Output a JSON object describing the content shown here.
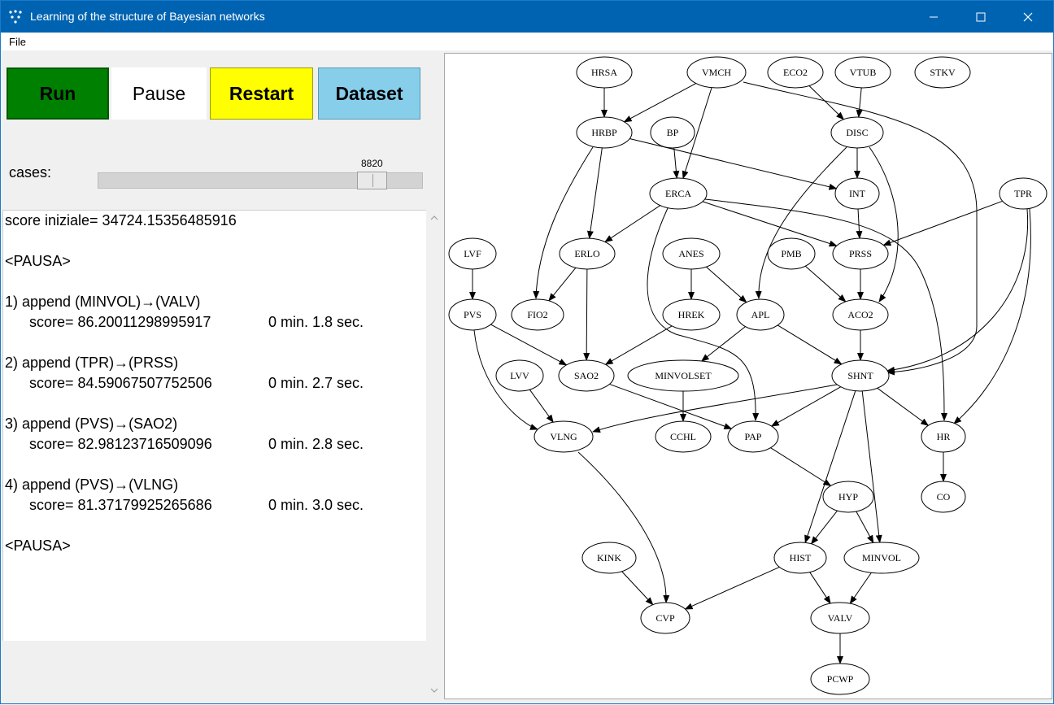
{
  "window": {
    "title": "Learning of the structure of Bayesian networks",
    "menu": [
      "File"
    ]
  },
  "toolbar": {
    "run_label": "Run",
    "pause_label": "Pause",
    "restart_label": "Restart",
    "dataset_label": "Dataset"
  },
  "cases": {
    "label": "cases:",
    "value": "8820"
  },
  "log": {
    "initial": "score iniziale= 34724.15356485916",
    "pause": "<PAUSA>",
    "steps": [
      {
        "action": "1) append (MINVOL)→(VALV)",
        "score": "score= 86.20011298995917",
        "time": "0 min. 1.8 sec."
      },
      {
        "action": "2) append (TPR)→(PRSS)",
        "score": "score= 84.59067507752506",
        "time": "0 min. 2.7 sec."
      },
      {
        "action": "3) append (PVS)→(SAO2)",
        "score": "score= 82.98123716509096",
        "time": "0 min. 2.8 sec."
      },
      {
        "action": "4) append (PVS)→(VLNG)",
        "score": "score= 81.37179925265686",
        "time": "0 min. 3.0 sec."
      }
    ]
  },
  "graph": {
    "nodes": [
      "HRSA",
      "VMCH",
      "ECO2",
      "VTUB",
      "STKV",
      "HRBP",
      "BP",
      "DISC",
      "INT",
      "ERCA",
      "TPR",
      "LVF",
      "ERLO",
      "ANES",
      "PMB",
      "PRSS",
      "PVS",
      "FIO2",
      "HREK",
      "APL",
      "ACO2",
      "LVV",
      "SAO2",
      "MINVOLSET",
      "SHNT",
      "VLNG",
      "CCHL",
      "PAP",
      "HR",
      "HYP",
      "CO",
      "KINK",
      "HIST",
      "MINVOL",
      "CVP",
      "VALV",
      "PCWP"
    ],
    "edges": [
      [
        "HRSA",
        "HRBP"
      ],
      [
        "VMCH",
        "HRBP"
      ],
      [
        "VMCH",
        "ERCA"
      ],
      [
        "VMCH",
        "SHNT"
      ],
      [
        "ECO2",
        "DISC"
      ],
      [
        "VTUB",
        "DISC"
      ],
      [
        "HRBP",
        "INT"
      ],
      [
        "HRBP",
        "ERLO"
      ],
      [
        "HRBP",
        "FIO2"
      ],
      [
        "BP",
        "ERCA"
      ],
      [
        "DISC",
        "INT"
      ],
      [
        "DISC",
        "APL"
      ],
      [
        "DISC",
        "ACO2"
      ],
      [
        "INT",
        "PRSS"
      ],
      [
        "ERCA",
        "ERLO"
      ],
      [
        "ERCA",
        "PRSS"
      ],
      [
        "ERCA",
        "HR"
      ],
      [
        "ERCA",
        "PAP"
      ],
      [
        "TPR",
        "PRSS"
      ],
      [
        "TPR",
        "SHNT"
      ],
      [
        "TPR",
        "HR"
      ],
      [
        "LVF",
        "PVS"
      ],
      [
        "ERLO",
        "FIO2"
      ],
      [
        "ERLO",
        "SAO2"
      ],
      [
        "ANES",
        "HREK"
      ],
      [
        "ANES",
        "APL"
      ],
      [
        "PMB",
        "ACO2"
      ],
      [
        "PRSS",
        "ACO2"
      ],
      [
        "PVS",
        "SAO2"
      ],
      [
        "PVS",
        "VLNG"
      ],
      [
        "HREK",
        "SAO2"
      ],
      [
        "APL",
        "MINVOLSET"
      ],
      [
        "APL",
        "SHNT"
      ],
      [
        "ACO2",
        "SHNT"
      ],
      [
        "LVV",
        "VLNG"
      ],
      [
        "SAO2",
        "PAP"
      ],
      [
        "MINVOLSET",
        "CCHL"
      ],
      [
        "SHNT",
        "VLNG"
      ],
      [
        "SHNT",
        "PAP"
      ],
      [
        "SHNT",
        "HR"
      ],
      [
        "SHNT",
        "HIST"
      ],
      [
        "SHNT",
        "MINVOL"
      ],
      [
        "PAP",
        "HYP"
      ],
      [
        "HR",
        "CO"
      ],
      [
        "HYP",
        "HIST"
      ],
      [
        "HYP",
        "MINVOL"
      ],
      [
        "VLNG",
        "CVP"
      ],
      [
        "KINK",
        "CVP"
      ],
      [
        "HIST",
        "CVP"
      ],
      [
        "HIST",
        "VALV"
      ],
      [
        "MINVOL",
        "VALV"
      ],
      [
        "VALV",
        "PCWP"
      ]
    ]
  },
  "colors": {
    "titlebar": "#0063b1",
    "run": "#008000",
    "pause": "#ffffff",
    "restart": "#ffff00",
    "dataset": "#87ceeb"
  }
}
